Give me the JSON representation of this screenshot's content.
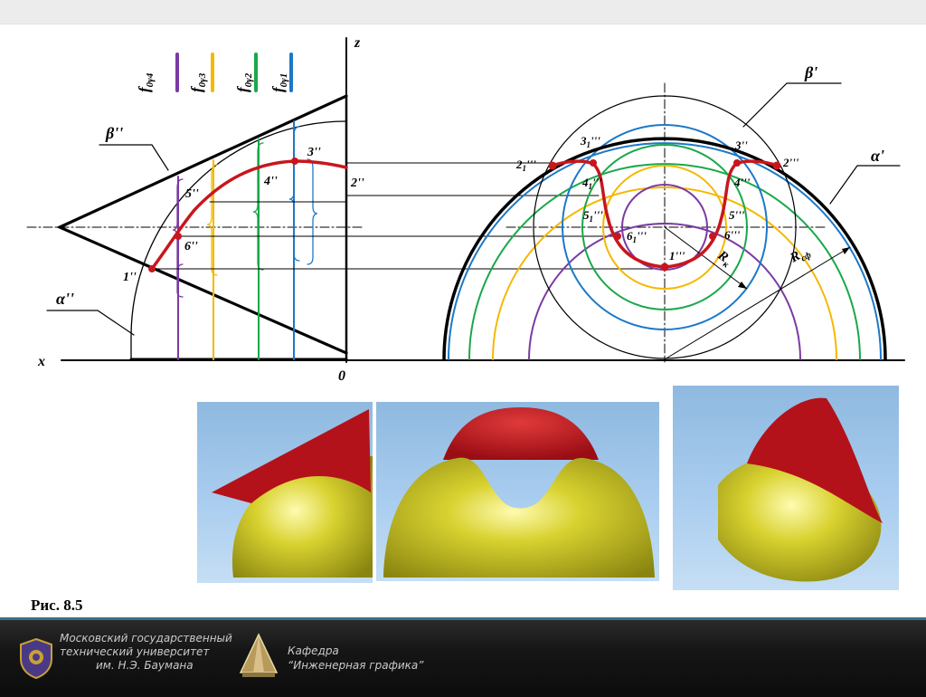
{
  "labels": {
    "z": "z",
    "x": "x",
    "origin": "0",
    "beta_front": "β''",
    "alpha_front": "α''",
    "beta_profile": "β'",
    "alpha_profile": "α'",
    "f4": "f",
    "f4_sub": "0γ4",
    "f3": "f",
    "f3_sub": "0γ3",
    "f2": "f",
    "f2_sub": "0γ2",
    "f1": "f",
    "f1_sub": "0γ1",
    "p1f": "1''",
    "p2f": "2''",
    "p3f": "3''",
    "p4f": "4''",
    "p5f": "5''",
    "p6f": "6''",
    "p1p": "1'''",
    "p2p": "2'''",
    "p3p": "3''",
    "p4p": "4'''",
    "p5p": "5'''",
    "p6p": "6'''",
    "p2s": "2",
    "p2s_sub": "1",
    "p2s_sup": "'''",
    "p3s": "3",
    "p3s_sub": "1",
    "p3s_sup": "'''",
    "p4s": "4",
    "p4s_sub": "1",
    "p4s_sup": "'''",
    "p5s": "5",
    "p5s_sub": "1",
    "p5s_sup": "'''",
    "p6s": "6",
    "p6s_sub": "1",
    "p6s_sup": "'''",
    "rk": "R",
    "rk_sub": "к",
    "rsf": "R",
    "rsf_sub": "сф"
  },
  "colors": {
    "curve": "#c8161d",
    "purple": "#7b3aa3",
    "yellow": "#f5b800",
    "green": "#1aa84a",
    "blue": "#1c78c8",
    "cone_red": "#b3121a",
    "sphere_yellow": "#c9c21e"
  },
  "caption": "Рис. 8.5",
  "footer": {
    "university_line1": "Московский государственный",
    "university_line2": "технический университет",
    "university_line3": "им. Н.Э. Баумана",
    "dept_line1": "Кафедра",
    "dept_line2": "“Инженерная графика”"
  }
}
